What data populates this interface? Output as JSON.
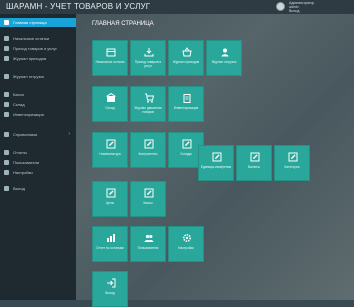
{
  "app": {
    "title": "ШАРАМН - УЧЕТ ТОВАРОВ И УСЛУГ"
  },
  "user": {
    "line1": "Администратор",
    "line2": "admin",
    "line3": "Выход"
  },
  "sidebar": {
    "items": [
      {
        "label": "Главная страница",
        "active": true
      },
      {
        "label": "Начальные остатки"
      },
      {
        "label": "Приход товаров и услуг"
      },
      {
        "label": "Журнал приходов"
      },
      {
        "label": "Журнал отгрузок"
      },
      {
        "label": "Касса"
      },
      {
        "label": "Склад"
      },
      {
        "label": "Инвентаризация"
      },
      {
        "label": "Справочники",
        "arrow": "›"
      },
      {
        "label": "Отчеты"
      },
      {
        "label": "Пользователи"
      },
      {
        "label": "Настройки"
      },
      {
        "label": "Выход"
      }
    ]
  },
  "main": {
    "page_title": "ГЛАВНАЯ СТРАНИЦА"
  },
  "tiles": [
    {
      "label": "Начальные остатки"
    },
    {
      "label": "Приход товаров и услуг"
    },
    {
      "label": "Журнал приходов"
    },
    {
      "label": "Журнал отгрузок"
    },
    {
      "label": "Склад"
    },
    {
      "label": "Журнал движения товаров"
    },
    {
      "label": "Инвентаризация"
    },
    {
      "label": "Номенклатура"
    },
    {
      "label": "Контрагенты"
    },
    {
      "label": "Склады"
    },
    {
      "label": "Единицы измерения"
    },
    {
      "label": "Валюты"
    },
    {
      "label": "Категории"
    },
    {
      "label": "Цены"
    },
    {
      "label": "Кассы"
    },
    {
      "label": "Отчет по остаткам"
    },
    {
      "label": "Пользователи"
    },
    {
      "label": "Настройки"
    },
    {
      "label": "Выход"
    }
  ]
}
